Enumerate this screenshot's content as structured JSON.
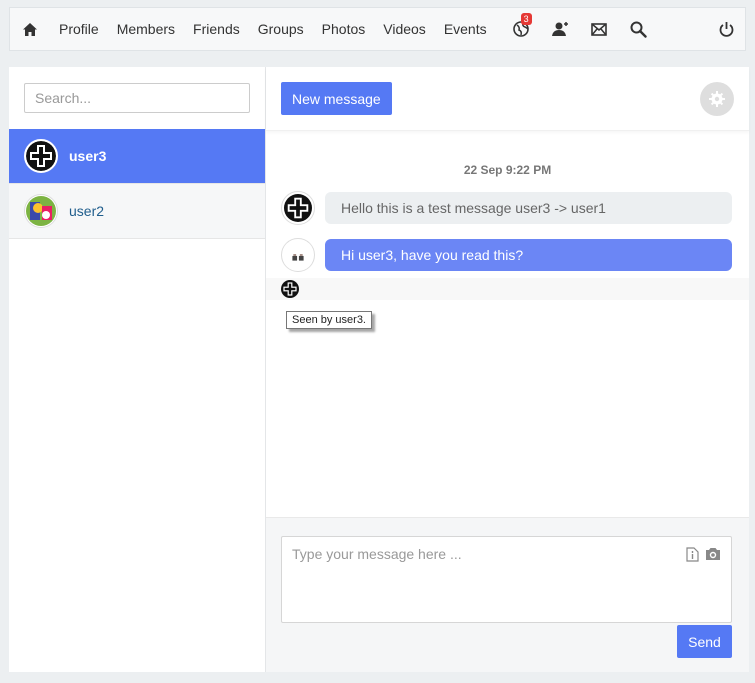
{
  "nav": {
    "links": [
      "Profile",
      "Members",
      "Friends",
      "Groups",
      "Photos",
      "Videos",
      "Events"
    ],
    "notifications_badge": "3",
    "icons": [
      "home-icon",
      "globe-notifications-icon",
      "friend-requests-icon",
      "messages-envelope-icon",
      "search-icon",
      "power-icon"
    ]
  },
  "sidebar": {
    "search_placeholder": "Search...",
    "conversations": [
      {
        "name": "user3",
        "active": true
      },
      {
        "name": "user2",
        "active": false
      }
    ]
  },
  "chat": {
    "new_message_label": "New message",
    "date": "22 Sep 9:22 PM",
    "messages": [
      {
        "text": "Hello this is a test message user3 -> user1",
        "direction": "in"
      },
      {
        "text": "Hi user3, have you read this?",
        "direction": "out"
      }
    ],
    "seen_tooltip": "Seen by user3.",
    "compose_placeholder": "Type your message here ...",
    "send_label": "Send"
  },
  "colors": {
    "accent": "#5579f4",
    "outgoing_bubble": "#6b86f5",
    "incoming_bubble": "#eceff1",
    "badge": "#e53935"
  }
}
